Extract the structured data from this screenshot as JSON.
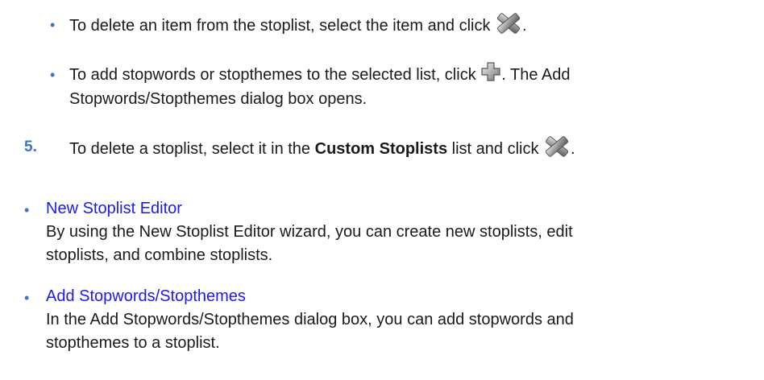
{
  "items": {
    "delete_item": {
      "text_before": "To delete an item from the stoplist, select the item and click",
      "text_after": ".",
      "icon": "delete-x-icon"
    },
    "add_stopwords": {
      "text_before": "To add stopwords or stopthemes to the selected list, click",
      "text_after_line1": ". The Add",
      "text_line2": "Stopwords/Stopthemes dialog box opens.",
      "icon": "add-plus-icon"
    },
    "step5": {
      "number": "5.",
      "text_before": "To delete a stoplist, select it in the",
      "bold": "Custom Stoplists",
      "text_middle": "list and click",
      "text_after": ".",
      "icon": "delete-x-icon"
    }
  },
  "related": [
    {
      "link": "New Stoplist Editor",
      "desc_line1": "By using the New Stoplist Editor wizard, you can create new stoplists, edit",
      "desc_line2": "stoplists, and combine stoplists."
    },
    {
      "link": "Add Stopwords/Stopthemes",
      "desc_line1": "In the Add Stopwords/Stopthemes dialog box, you can add stopwords and",
      "desc_line2": "stopthemes to a stoplist."
    }
  ],
  "colors": {
    "bullet": "#3a74c4",
    "link": "#1a1af0",
    "text": "#1a1a1a"
  }
}
